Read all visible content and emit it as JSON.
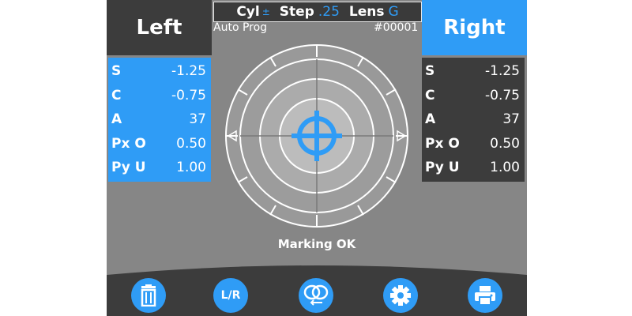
{
  "header": {
    "left_label": "Left",
    "right_label": "Right",
    "cyl_label": "Cyl",
    "cyl_symbol": "±",
    "step_label": "Step",
    "step_value": ".25",
    "lens_label": "Lens",
    "lens_value": "G",
    "mode": "Auto Prog",
    "serial": "#00001"
  },
  "left_panel": {
    "rows": [
      {
        "label": "S",
        "value": "-1.25"
      },
      {
        "label": "C",
        "value": "-0.75"
      },
      {
        "label": "A",
        "value": "37"
      },
      {
        "label": "Px O",
        "value": "0.50"
      },
      {
        "label": "Py U",
        "value": "1.00"
      }
    ]
  },
  "right_panel": {
    "rows": [
      {
        "label": "S",
        "value": "-1.25"
      },
      {
        "label": "C",
        "value": "-0.75"
      },
      {
        "label": "A",
        "value": "37"
      },
      {
        "label": "Px O",
        "value": "0.50"
      },
      {
        "label": "Py U",
        "value": "1.00"
      }
    ]
  },
  "status": "Marking OK",
  "toolbar": {
    "delete_icon": "trash-icon",
    "lr_label": "L/R",
    "lens_icon": "lens-swap-icon",
    "settings_icon": "gear-icon",
    "print_icon": "printer-icon"
  },
  "colors": {
    "accent": "#2f9cf6",
    "dark_panel": "#3c3c3c",
    "screen_bg": "#868686"
  }
}
